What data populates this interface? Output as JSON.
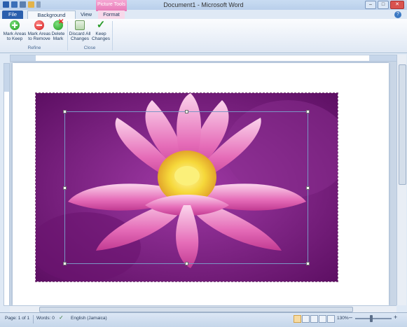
{
  "window": {
    "title": "Document1 - Microsoft Word",
    "context_group": "Picture Tools"
  },
  "tabs": {
    "file": "File",
    "background_removal": "Background Removal",
    "view": "View",
    "format": "Format"
  },
  "ribbon": {
    "mark_keep": "Mark Areas\nto Keep",
    "mark_remove": "Mark Areas\nto Remove",
    "delete_mark": "Delete\nMark",
    "discard": "Discard All\nChanges",
    "keep_changes": "Keep\nChanges",
    "group_refine": "Refine",
    "group_close": "Close"
  },
  "status": {
    "page": "Page: 1 of 1",
    "words": "Words: 0",
    "language": "English (Jamaica)",
    "zoom": "130%"
  },
  "colors": {
    "photo_background": "#7a1a7f",
    "petal": "#e36fb7",
    "center": "#f6df3c"
  },
  "icons": [
    "save-icon",
    "undo-icon",
    "open-icon",
    "check-icon",
    "help-icon"
  ]
}
